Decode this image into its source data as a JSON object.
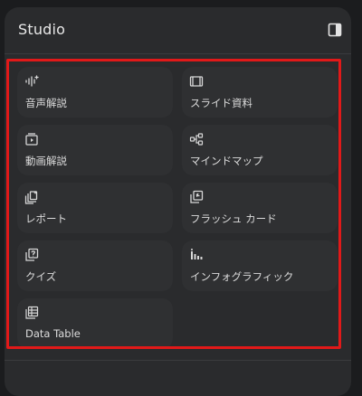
{
  "studio": {
    "title": "Studio",
    "cards": [
      {
        "label": "音声解説",
        "icon": "audio-waveform-icon"
      },
      {
        "label": "スライド資料",
        "icon": "slides-icon"
      },
      {
        "label": "動画解説",
        "icon": "video-icon"
      },
      {
        "label": "マインドマップ",
        "icon": "mindmap-icon"
      },
      {
        "label": "レポート",
        "icon": "report-icon"
      },
      {
        "label": "フラッシュ カード",
        "icon": "flashcard-icon"
      },
      {
        "label": "クイズ",
        "icon": "quiz-icon"
      },
      {
        "label": "インフォグラフィック",
        "icon": "infographic-icon"
      },
      {
        "label": "Data Table",
        "icon": "data-table-icon"
      }
    ]
  },
  "colors": {
    "background": "#1b1c1e",
    "panel": "#2a2b2d",
    "card": "#2f3032",
    "highlight": "#e11919"
  }
}
